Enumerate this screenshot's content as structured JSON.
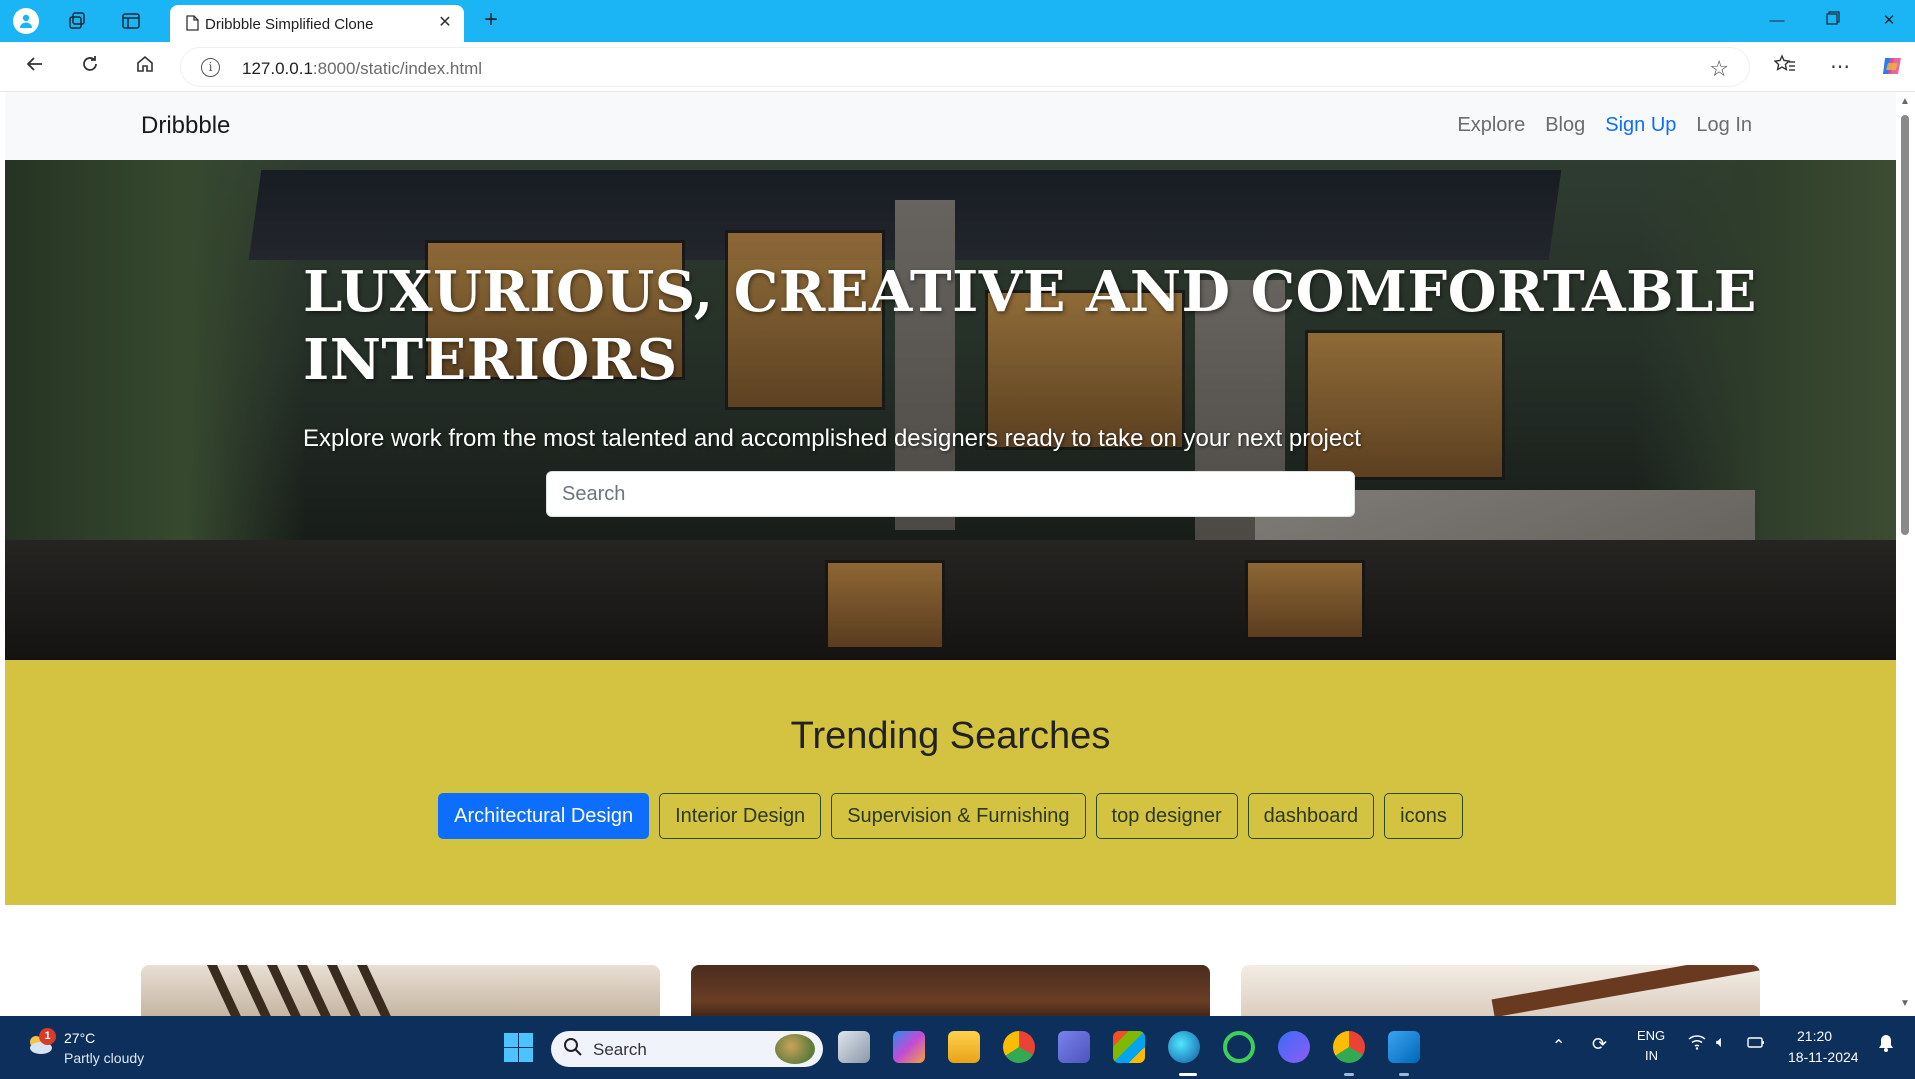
{
  "browser": {
    "tab_title": "Dribbble Simplified Clone",
    "url_host": "127.0.0.1",
    "url_path": ":8000/static/index.html"
  },
  "site": {
    "brand": "Dribbble",
    "nav": [
      "Explore",
      "Blog",
      "Sign Up",
      "Log In"
    ],
    "active_nav": "Sign Up"
  },
  "hero": {
    "title": "LUXURIOUS, CREATIVE AND COMFORTABLE INTERIORS",
    "subtitle": "Explore work from the most talented and accomplished designers ready to take on your next project",
    "search_placeholder": "Search"
  },
  "trending": {
    "heading": "Trending Searches",
    "chips": [
      "Architectural Design",
      "Interior Design",
      "Supervision & Furnishing",
      "top designer",
      "dashboard",
      "icons"
    ],
    "active_chip": "Architectural Design"
  },
  "taskbar": {
    "weather_temp": "27°C",
    "weather_cond": "Partly cloudy",
    "weather_badge": "1",
    "search_label": "Search",
    "lang_top": "ENG",
    "lang_bottom": "IN",
    "time": "21:20",
    "date": "18-11-2024"
  },
  "colors": {
    "accent_blue": "#0d6efd",
    "trending_bg": "#d4c341",
    "tabbar_bg": "#1bb4f4",
    "taskbar_bg": "#0c2f5c"
  }
}
